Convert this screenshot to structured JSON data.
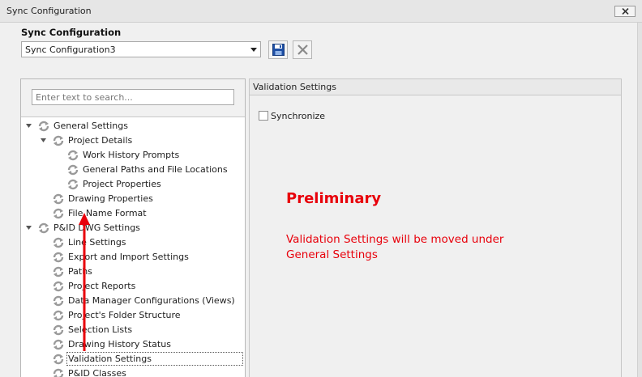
{
  "window": {
    "title": "Sync Configuration"
  },
  "section_label": "Sync Configuration",
  "config_combo": {
    "value": "Sync Configuration3"
  },
  "search": {
    "placeholder": "Enter text to search..."
  },
  "tree": {
    "items": [
      {
        "label": "General Settings",
        "level": 0,
        "expanded": true
      },
      {
        "label": "Project Details",
        "level": 1,
        "expanded": true
      },
      {
        "label": "Work History Prompts",
        "level": 2
      },
      {
        "label": "General Paths and File Locations",
        "level": 2
      },
      {
        "label": "Project Properties",
        "level": 2
      },
      {
        "label": "Drawing Properties",
        "level": 1
      },
      {
        "label": "File Name Format",
        "level": 1
      },
      {
        "label": "P&ID DWG Settings",
        "level": 0,
        "expanded": true
      },
      {
        "label": "Line Settings",
        "level": 1
      },
      {
        "label": "Export and Import Settings",
        "level": 1
      },
      {
        "label": "Paths",
        "level": 1
      },
      {
        "label": "Project Reports",
        "level": 1
      },
      {
        "label": "Data Manager Configurations (Views)",
        "level": 1
      },
      {
        "label": "Project's Folder Structure",
        "level": 1
      },
      {
        "label": "Selection Lists",
        "level": 1
      },
      {
        "label": "Drawing History Status",
        "level": 1
      },
      {
        "label": "Validation Settings",
        "level": 1,
        "selected": true
      },
      {
        "label": "P&ID Classes",
        "level": 1
      }
    ]
  },
  "settings_panel": {
    "header": "Validation Settings",
    "synchronize_label": "Synchronize",
    "synchronize_checked": false
  },
  "annotation": {
    "title": "Preliminary",
    "lines": [
      "Validation Settings will be moved under",
      "General Settings"
    ]
  },
  "colors": {
    "annotation": "#e8000b",
    "sync_icon": "#9a9a9a",
    "save_icon": "#1e4fa5"
  },
  "icons": {
    "close": "close-icon",
    "save": "save-icon",
    "delete": "delete-icon",
    "tree_node": "sync-node-icon",
    "expander": "triangle-down-icon",
    "combo_arrow": "chevron-down-icon"
  }
}
